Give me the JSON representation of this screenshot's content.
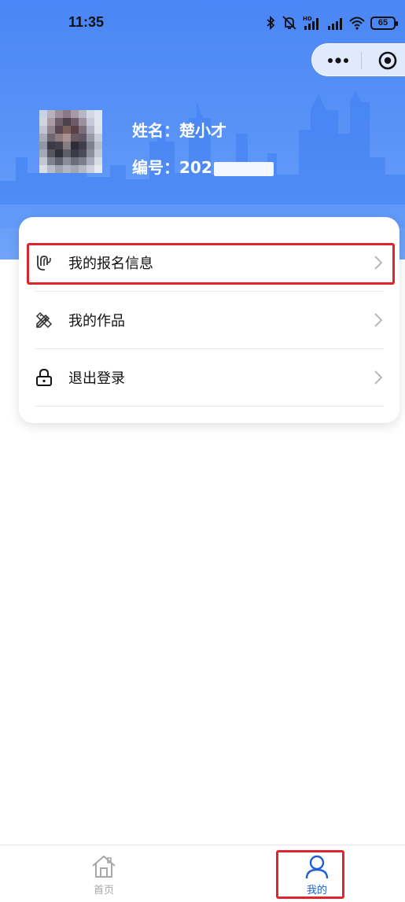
{
  "status_bar": {
    "time": "11:35",
    "battery": "65",
    "icons": [
      "bluetooth-icon",
      "mute-icon",
      "hd-signal-icon",
      "signal-icon",
      "wifi-icon",
      "battery-icon"
    ]
  },
  "capsule": {
    "more_icon": "more-dots-icon",
    "close_icon": "target-circle-icon"
  },
  "profile": {
    "name_label": "姓名：",
    "name_value": "楚小才",
    "id_label": "编号：",
    "id_value": "202"
  },
  "menu": {
    "items": [
      {
        "label": "我的报名信息",
        "icon": "registration-icon"
      },
      {
        "label": "我的作品",
        "icon": "pencil-ruler-icon"
      },
      {
        "label": "退出登录",
        "icon": "lock-icon"
      }
    ]
  },
  "tabbar": {
    "home_label": "首页",
    "mine_label": "我的"
  },
  "colors": {
    "header_blue": "#4a86f5",
    "highlight_red": "#e0242b",
    "active_tab": "#1f5fd6",
    "inactive_tab": "#a8a8a8"
  }
}
